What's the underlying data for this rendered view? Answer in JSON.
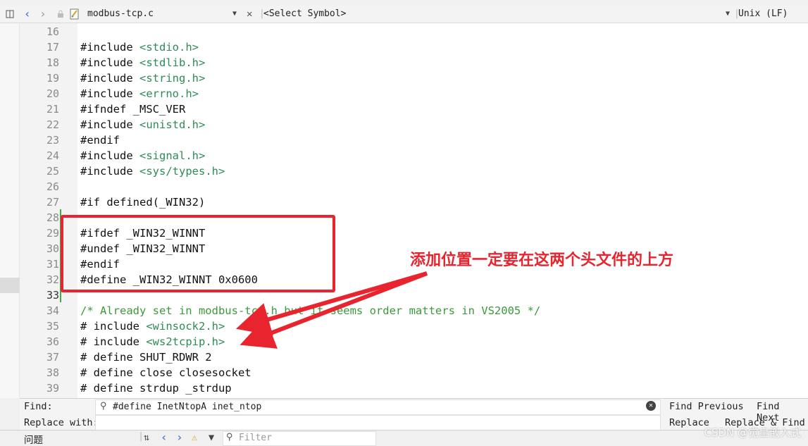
{
  "menubar": {
    "text": ""
  },
  "toolbar": {
    "file_name": "modbus-tcp.c",
    "symbol_placeholder": "<Select Symbol>",
    "line_ending": "Unix (LF)"
  },
  "editor": {
    "current_line": 33,
    "lines": [
      {
        "n": "16",
        "c": ""
      },
      {
        "n": "17",
        "c": "#include ",
        "i": "<stdio.h>"
      },
      {
        "n": "18",
        "c": "#include ",
        "i": "<stdlib.h>"
      },
      {
        "n": "19",
        "c": "#include ",
        "i": "<string.h>"
      },
      {
        "n": "20",
        "c": "#include ",
        "i": "<errno.h>"
      },
      {
        "n": "21",
        "c": "#ifndef _MSC_VER"
      },
      {
        "n": "22",
        "c": "#include ",
        "i": "<unistd.h>"
      },
      {
        "n": "23",
        "c": "#endif"
      },
      {
        "n": "24",
        "c": "#include ",
        "i": "<signal.h>"
      },
      {
        "n": "25",
        "c": "#include ",
        "i": "<sys/types.h>"
      },
      {
        "n": "26",
        "c": ""
      },
      {
        "n": "27",
        "c": "#if defined(_WIN32)"
      },
      {
        "n": "28",
        "c": ""
      },
      {
        "n": "29",
        "c": "#ifdef _WIN32_WINNT"
      },
      {
        "n": "30",
        "c": "#undef _WIN32_WINNT"
      },
      {
        "n": "31",
        "c": "#endif"
      },
      {
        "n": "32",
        "c": "#define _WIN32_WINNT 0x0600"
      },
      {
        "n": "33",
        "c": ""
      },
      {
        "n": "34",
        "cm": "/* Already set in modbus-tcp.h but it seems order matters in VS2005 */"
      },
      {
        "n": "35",
        "c": "# include ",
        "i": "<winsock2.h>"
      },
      {
        "n": "36",
        "c": "# include ",
        "i": "<ws2tcpip.h>"
      },
      {
        "n": "37",
        "c": "# define SHUT_RDWR 2"
      },
      {
        "n": "38",
        "c": "# define close closesocket"
      },
      {
        "n": "39",
        "c": "# define strdup _strdup"
      }
    ]
  },
  "annotation": {
    "text": "添加位置一定要在这两个头文件的上方"
  },
  "find": {
    "find_label": "Find:",
    "find_value": "#define InetNtopA inet_ntop",
    "replace_label": "Replace with:",
    "replace_value": "",
    "find_previous": "Find Previous",
    "find_next": "Find Next",
    "replace": "Replace",
    "replace_and_find": "Replace & Find"
  },
  "status": {
    "problems_tab": "问题",
    "filter_placeholder": "Filter"
  },
  "watermark": "CSDN @觉皇嵌入式",
  "colors": {
    "accent_red": "#e8252f",
    "include_green": "#2e8b57",
    "comment_green": "#3a9a3a"
  }
}
